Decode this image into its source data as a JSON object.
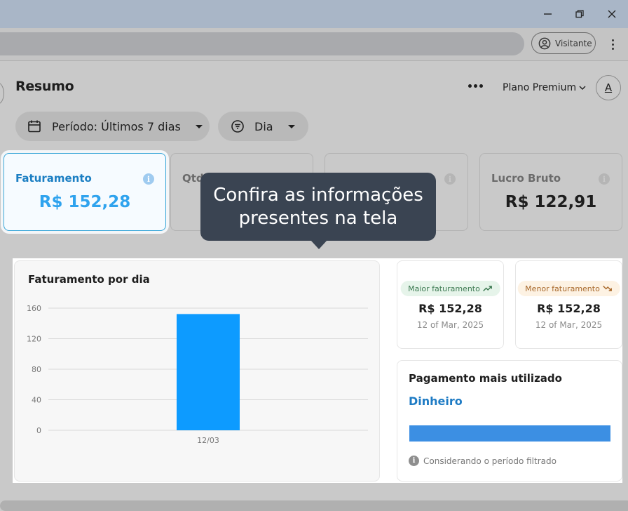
{
  "browser": {
    "profile_label": "Visitante"
  },
  "header": {
    "title": "Resumo",
    "plan_label": "Plano Premium",
    "avatar_letter": "A"
  },
  "filters": {
    "period_label": "Período: Últimos 7 dias",
    "group_label": "Dia"
  },
  "kpis": [
    {
      "label": "Faturamento",
      "value": "R$ 152,28",
      "active": true
    },
    {
      "label": "Qtd",
      "value": ""
    },
    {
      "label": "",
      "value": ""
    },
    {
      "label": "Lucro Bruto",
      "value": "R$ 122,91"
    }
  ],
  "tooltip": {
    "line1": "Confira as informações",
    "line2": "presentes na tela"
  },
  "chart_data": {
    "type": "bar",
    "title": "Faturamento por dia",
    "categories": [
      "12/03"
    ],
    "values": [
      152.28
    ],
    "ylim": [
      0,
      160
    ],
    "yticks": [
      0,
      40,
      80,
      120,
      160
    ],
    "xlabel": "",
    "ylabel": "",
    "grid": true,
    "bar_color": "#0d9bff"
  },
  "stats": {
    "max": {
      "badge": "Maior faturamento",
      "value": "R$ 152,28",
      "date": "12 of Mar, 2025",
      "badge_bg": "#e6f4ea",
      "badge_color": "#3d7a52"
    },
    "min": {
      "badge": "Menor faturamento",
      "value": "R$ 152,28",
      "date": "12 of Mar, 2025",
      "badge_bg": "#fdf2e3",
      "badge_color": "#a8682a"
    }
  },
  "payment": {
    "title": "Pagamento mais utilizado",
    "method": "Dinheiro",
    "share": 1.0,
    "note": "Considerando o período filtrado"
  }
}
